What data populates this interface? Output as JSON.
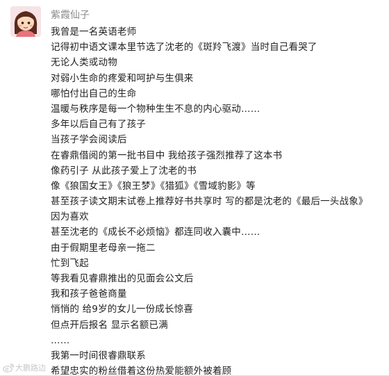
{
  "post": {
    "author": "紫霞仙子",
    "avatar_icon": "cartoon-girl-avatar",
    "lines": [
      "我曾是一名英语老师",
      "记得初中语文课本里节选了沈老的《斑羚飞渡》当时自己看哭了",
      "无论人类或动物",
      "对弱小生命的疼爱和呵护与生俱来",
      "哪怕付出自己的生命",
      "温暖与秩序是每一个物种生生不息的内心驱动……",
      "多年以后自己有了孩子",
      "当孩子学会阅读后",
      "在睿鼎借阅的第一批书目中 我给孩子强烈推荐了这本书",
      "像药引子 从此孩子爱上了沈老的书",
      "像《狼国女王》《狼王梦》《猎狐》《雪域豹影》等",
      "甚至孩子读文期末试卷上推荐好书共享时 写的都是沈老的《最后一头战象》",
      "因为喜欢",
      "甚至沈老的《成长不必烦恼》都连同收入囊中……",
      "由于假期里老母亲一拖二",
      "忙到飞起",
      "等我看见睿鼎推出的见面会公文后",
      "我和孩子爸爸商量",
      "悄悄的 给9岁的女儿一份成长惊喜",
      "但点开后报名 显示名额已满",
      "……",
      "我第一时间很睿鼎联系",
      "希望忠实的粉丝借着这份热爱能额外被着顾"
    ]
  },
  "watermark": {
    "text": "大鹏路边",
    "icon": "weibo-icon"
  }
}
